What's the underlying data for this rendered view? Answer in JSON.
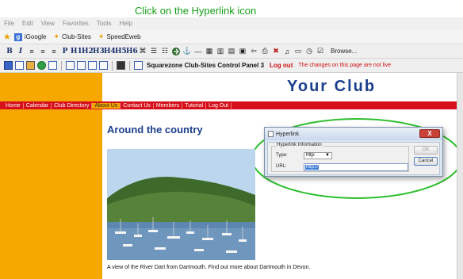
{
  "annotation": {
    "text": "Click on the Hyperlink icon",
    "color": "#17a017"
  },
  "browser": {
    "menu": [
      "File",
      "Edit",
      "View",
      "Favorites",
      "Tools",
      "Help"
    ],
    "favorites": [
      "iGoogle",
      "Club-Sites",
      "SpeedEweb"
    ]
  },
  "toolbar1": {
    "buttons": [
      "B",
      "I",
      "H1",
      "H2",
      "H3",
      "H4",
      "H5",
      "H6"
    ],
    "p_label": "P",
    "browse_label": "Browse..."
  },
  "toolbar2": {
    "control_panel_title": "Squarezone Club-Sites Control Panel 3",
    "logout_label": "Log out",
    "warning": "The changes on this page are not live"
  },
  "page": {
    "title": "Your Club",
    "nav": [
      "Home",
      "Calendar",
      "Club Directory",
      "About Us",
      "Contact Us",
      "Members",
      "Tutorial",
      "Log Out"
    ],
    "active_nav": "About Us",
    "heading": "Around the country",
    "caption": "A view of the River Dart from Dartmouth.  Find out more about Dartmouth in Devon."
  },
  "dialog": {
    "title": "Hyperlink",
    "close_label": "X",
    "group_label": "Hyperlink Information",
    "type_label": "Type:",
    "type_value": "http:",
    "url_label": "URL:",
    "url_value": "http://",
    "ok_label": "OK",
    "cancel_label": "Cancel"
  },
  "colors": {
    "accent_orange": "#f7a800",
    "nav_red": "#d6101b",
    "title_blue": "#1a3f8c",
    "highlight_green": "#17a017"
  }
}
